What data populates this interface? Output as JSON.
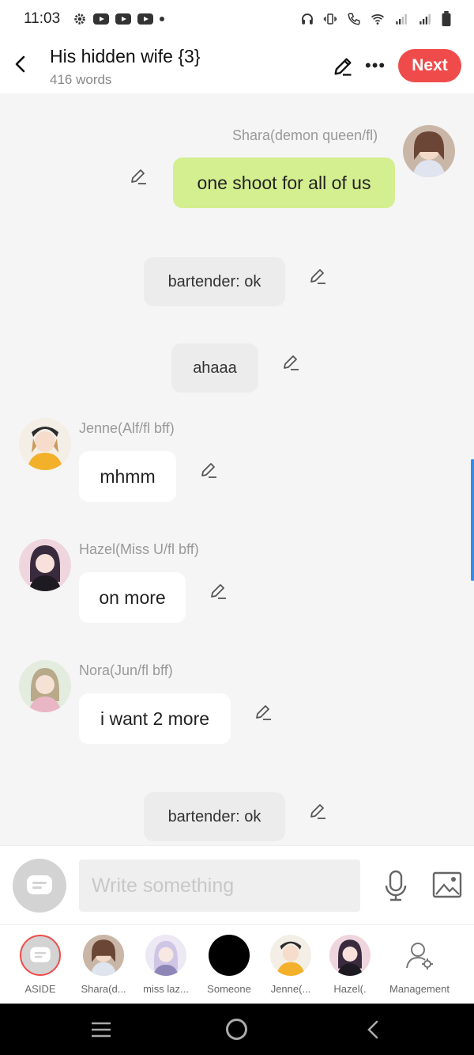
{
  "status": {
    "time": "11:03"
  },
  "header": {
    "title": "His hidden wife {3}",
    "word_count": "416 words",
    "next_label": "Next"
  },
  "messages": [
    {
      "speaker": "Shara(demon queen/fl)",
      "text": "one shoot for all of us",
      "side": "right"
    },
    {
      "speaker": "",
      "text": "bartender: ok",
      "side": "narration"
    },
    {
      "speaker": "",
      "text": "ahaaa",
      "side": "narration"
    },
    {
      "speaker": "Jenne(Alf/fl bff)",
      "text": "mhmm",
      "side": "left"
    },
    {
      "speaker": "Hazel(Miss U/fl bff)",
      "text": "on more",
      "side": "left"
    },
    {
      "speaker": "Nora(Jun/fl bff)",
      "text": "i want 2 more",
      "side": "left"
    },
    {
      "speaker": "",
      "text": "bartender: ok",
      "side": "narration"
    }
  ],
  "composer": {
    "placeholder": "Write something"
  },
  "characters": [
    {
      "label": "ASIDE"
    },
    {
      "label": "Shara(d..."
    },
    {
      "label": "miss laz..."
    },
    {
      "label": "Someone"
    },
    {
      "label": "Jenne(..."
    },
    {
      "label": "Hazel(."
    },
    {
      "label": "Management"
    }
  ],
  "colors": {
    "accent": "#f04b4b",
    "user_bubble": "#d4ef8f",
    "narration_bubble": "#ececec",
    "scroll_indicator": "#2f8ff0"
  }
}
